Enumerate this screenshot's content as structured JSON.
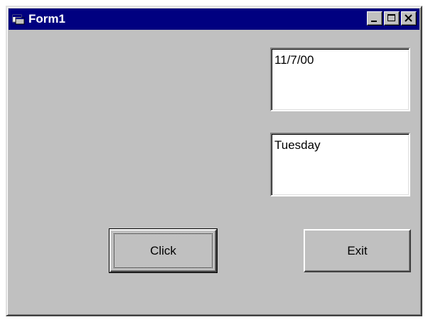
{
  "window": {
    "title": "Form1",
    "icon": "form-window-icon",
    "controls": [
      "minimize-icon",
      "maximize-icon",
      "close-icon"
    ]
  },
  "form": {
    "date_text": "11/7/00",
    "day_text": "Tuesday",
    "click_label": "Click",
    "exit_label": "Exit"
  },
  "colors": {
    "titlebar": "#000080",
    "form_background": "#c0c0c0",
    "textbox_background": "#ffffff"
  }
}
